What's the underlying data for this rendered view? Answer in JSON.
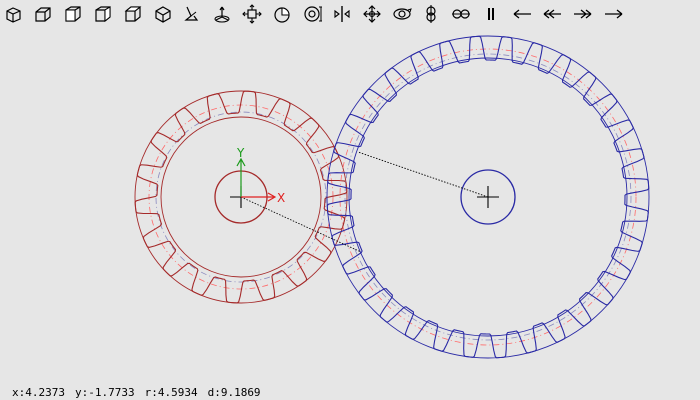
{
  "toolbar": {
    "tools": [
      {
        "name": "view-front-icon"
      },
      {
        "name": "view-back-icon"
      },
      {
        "name": "view-left-icon"
      },
      {
        "name": "view-right-icon"
      },
      {
        "name": "view-top-icon"
      },
      {
        "name": "view-iso-icon"
      },
      {
        "name": "pointer-tool-icon"
      },
      {
        "name": "axis-tool-icon"
      },
      {
        "name": "move-icon"
      },
      {
        "name": "rotate-view-icon"
      },
      {
        "name": "target-icon"
      },
      {
        "name": "mirror-icon"
      },
      {
        "name": "pan-icon"
      },
      {
        "name": "orbit-icon"
      },
      {
        "name": "vertical-link-icon"
      },
      {
        "name": "horizontal-link-icon"
      },
      {
        "name": "pause-icon"
      },
      {
        "name": "step-back-icon"
      },
      {
        "name": "rewind-icon"
      },
      {
        "name": "fast-forward-icon"
      },
      {
        "name": "step-forward-icon"
      }
    ]
  },
  "axes": {
    "x_label": "X",
    "y_label": "Y"
  },
  "gears": {
    "small": {
      "teeth": 18,
      "color": "#a52a2a"
    },
    "large": {
      "teeth": 32,
      "color": "#2a2aa5"
    },
    "pitch_color": "#ff6a6a",
    "ref_color": "#8a8abf"
  },
  "status": {
    "x": "x:4.2373",
    "y": "y:-1.7733",
    "r": "r:4.5934",
    "d": "d:9.1869"
  }
}
